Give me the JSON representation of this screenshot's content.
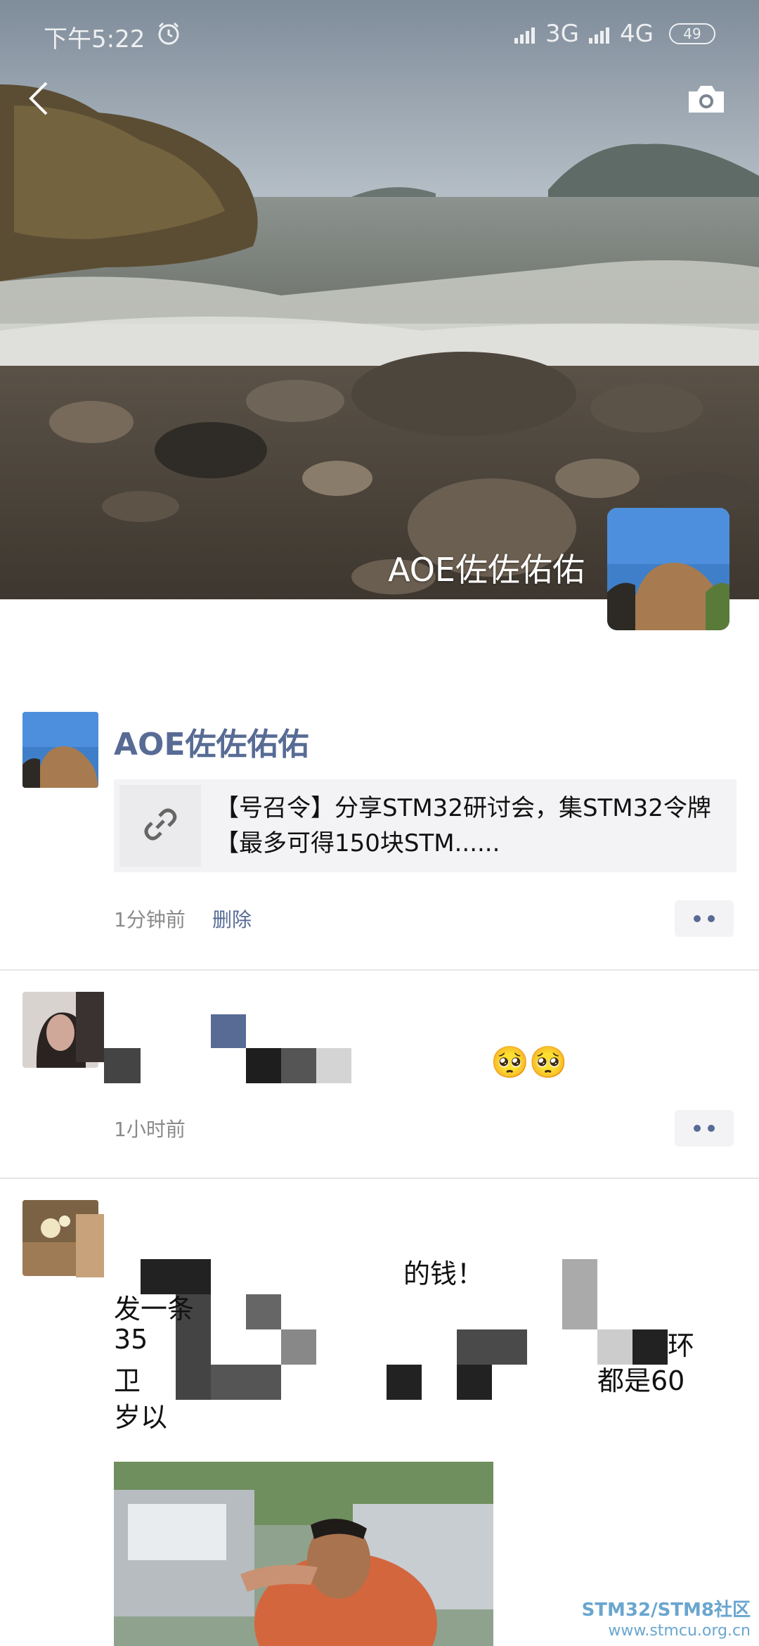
{
  "status_bar": {
    "time": "下午5:22",
    "network_1": "3G",
    "network_2": "4G",
    "battery": "49"
  },
  "cover": {
    "user_name": "AOE佐佐佑佑"
  },
  "posts": [
    {
      "author": "AOE佐佐佑佑",
      "link_text": "【号召令】分享STM32研讨会，集STM32令牌【最多可得150块STM......",
      "time": "1分钟前",
      "delete_label": "删除"
    },
    {
      "emoji": "🥺🥺",
      "time": "1小时前"
    },
    {
      "text_fragments": [
        "的钱！",
        "发一条",
        "35",
        "环",
        "卫",
        "都是60",
        "岁以"
      ]
    }
  ],
  "watermark": {
    "line1": "STM32/STM8社区",
    "line2": "www.stmcu.org.cn"
  },
  "colors": {
    "name_link": "#576b95",
    "card_bg": "#f3f3f5",
    "meta_gray": "#8a8a8a"
  },
  "icons": [
    "alarm-icon",
    "signal-icon",
    "battery-icon",
    "back-icon",
    "camera-icon",
    "link-icon",
    "more-icon"
  ]
}
